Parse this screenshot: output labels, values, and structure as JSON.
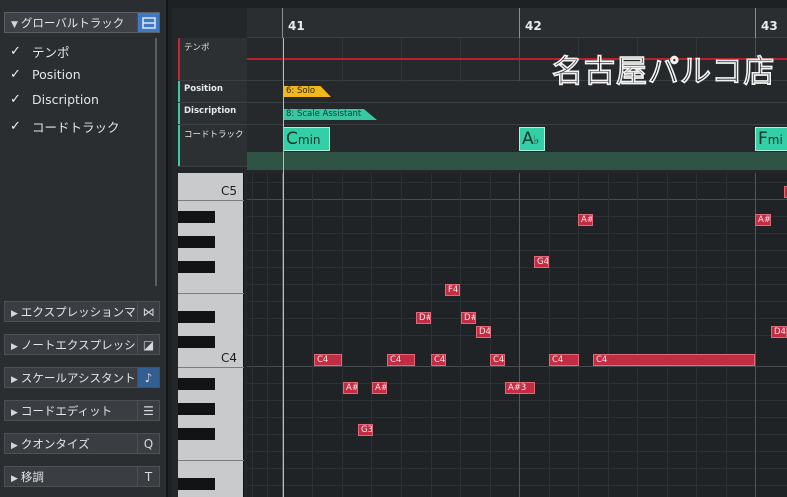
{
  "inspector": {
    "global_tracks": {
      "label": "グローバルトラック",
      "items": [
        {
          "check": "✓",
          "label": "テンポ"
        },
        {
          "check": "✓",
          "label": "Position"
        },
        {
          "check": "✓",
          "label": "Discription"
        },
        {
          "check": "✓",
          "label": "コードトラック"
        }
      ]
    },
    "sections": [
      {
        "label": "エクスプレッションマップ",
        "icon": "⋈",
        "icon_name": "expression-map-icon"
      },
      {
        "label": "ノートエクスプレッション",
        "icon": "◪",
        "icon_name": "note-expression-icon"
      },
      {
        "label": "スケールアシスタント",
        "icon": "♪",
        "icon_name": "scale-assistant-icon"
      },
      {
        "label": "コードエディット",
        "icon": "☰",
        "icon_name": "chord-edit-icon"
      },
      {
        "label": "クオンタイズ",
        "icon": "Q",
        "icon_name": "quantize-icon"
      },
      {
        "label": "移調",
        "icon": "T",
        "icon_name": "transpose-icon"
      }
    ]
  },
  "ruler": {
    "bars": [
      "41",
      "42",
      "43"
    ]
  },
  "tracks": {
    "tempo": {
      "name": "テンポ"
    },
    "position": {
      "name": "Position",
      "event": "6: Solo"
    },
    "discription": {
      "name": "Discription",
      "event": "8: Scale Assistant"
    },
    "chord": {
      "name": "コードトラック"
    }
  },
  "chords": [
    {
      "root": "C",
      "suffix": "min"
    },
    {
      "root": "A",
      "suffix": "♭"
    },
    {
      "root": "F",
      "suffix": "mi"
    }
  ],
  "watermark": "名古屋パルコ店",
  "keyboard": {
    "c5": "C5",
    "c4": "C4"
  },
  "notes": [
    {
      "pitch": "C4"
    },
    {
      "pitch": "A#3"
    },
    {
      "pitch": "A#"
    },
    {
      "pitch": "G3"
    },
    {
      "pitch": "C4"
    },
    {
      "pitch": "D#"
    },
    {
      "pitch": "F4"
    },
    {
      "pitch": "C4"
    },
    {
      "pitch": "D#"
    },
    {
      "pitch": "D4"
    },
    {
      "pitch": "C4"
    },
    {
      "pitch": "A#3"
    },
    {
      "pitch": "G4"
    },
    {
      "pitch": "C4"
    },
    {
      "pitch": "A#"
    },
    {
      "pitch": "C4"
    },
    {
      "pitch": "A#"
    },
    {
      "pitch": "D4"
    }
  ],
  "colors": {
    "note": "#c22d44",
    "chord": "#34cfa7",
    "position_tag": "#f0b81c",
    "discription_tag": "#38c7a2",
    "tempo_line": "#b8202a",
    "active_icon": "#3e79c2"
  }
}
